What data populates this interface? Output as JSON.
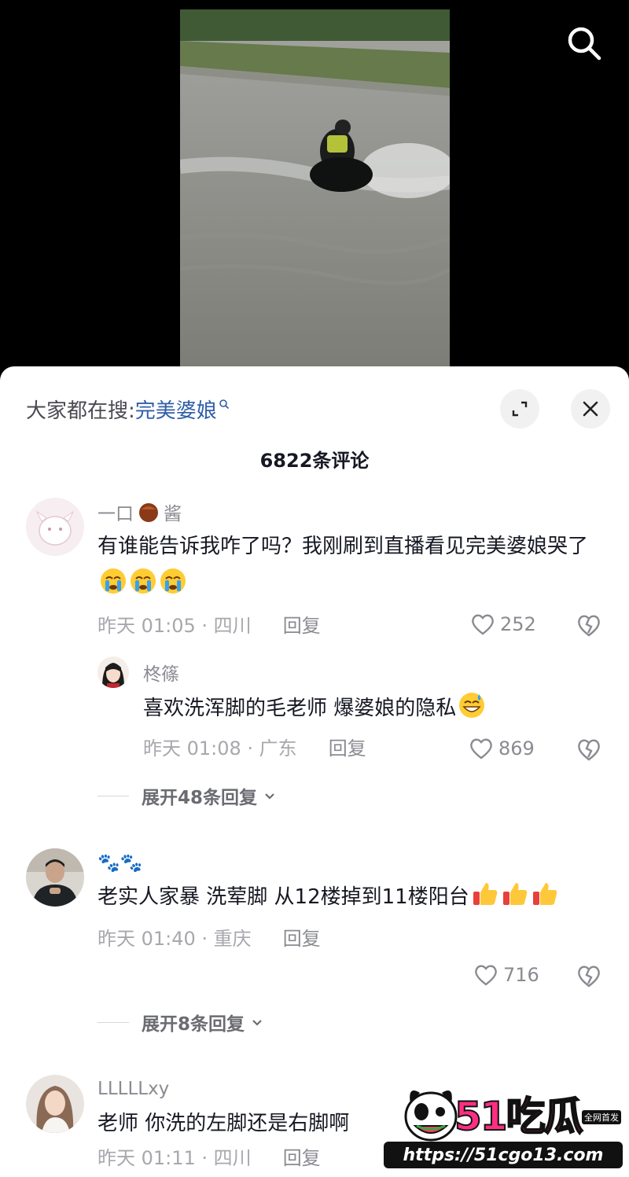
{
  "search_icon": "search-icon",
  "trending": {
    "prefix": "大家都在搜:",
    "keyword": "完美婆娘"
  },
  "comment_count": "6822条评论",
  "comments": [
    {
      "username_a": "一口",
      "username_b": "酱",
      "text": "有谁能告诉我咋了吗？我刚刷到直播看见完美婆娘哭了",
      "emoji": "loudly-crying-face x3",
      "time_loc": "昨天 01:05 · 四川",
      "reply": "回复",
      "likes": "252",
      "subreply": {
        "username": "柊篠",
        "text": "喜欢洗浑脚的毛老师 爆婆娘的隐私",
        "emoji": "grinning-sweat-face",
        "time_loc": "昨天 01:08 · 广东",
        "reply": "回复",
        "likes": "869"
      },
      "expand": "展开48条回复"
    },
    {
      "username": "🐾🐾",
      "text": "老实人家暴 洗荤脚 从12楼掉到11楼阳台",
      "emoji": "thumbs-up x3",
      "time_loc": "昨天 01:40 · 重庆",
      "reply": "回复",
      "likes": "716",
      "expand": "展开8条回复"
    },
    {
      "username": "LLLLLxy",
      "text": "老师 你洗的左脚还是右脚啊",
      "time_loc": "昨天 01:11 · 四川",
      "reply": "回复"
    }
  ],
  "watermark": {
    "brand": "51吃瓜",
    "tag": "全网首发",
    "url": "https://51cgo13.com"
  },
  "colors": {
    "link": "#2f5fa8",
    "meta": "#a7a8ad",
    "text": "#161823",
    "brand": "#ff2e83"
  }
}
